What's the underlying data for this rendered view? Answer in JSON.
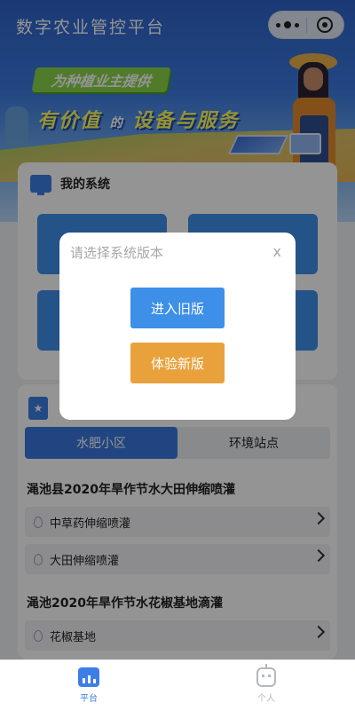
{
  "header": {
    "app_title": "数字农业管控平台",
    "banner_tag": "为种植业主提供",
    "banner_slogan_part1": "有价值",
    "banner_slogan_part2": "的",
    "banner_slogan_part3": "设备与服务"
  },
  "my_system": {
    "title": "我的系统",
    "tiles": [
      "",
      "",
      "",
      ""
    ]
  },
  "sites": {
    "tabs": [
      {
        "label": "水肥小区",
        "active": true
      },
      {
        "label": "环境站点",
        "active": false
      }
    ],
    "groups": [
      {
        "title": "渑池县2020年旱作节水大田伸缩喷灌",
        "items": [
          "中草药伸缩喷灌",
          "大田伸缩喷灌"
        ]
      },
      {
        "title": "渑池2020年旱作节水花椒基地滴灌",
        "items": [
          "花椒基地"
        ]
      }
    ]
  },
  "dialog": {
    "title": "请选择系统版本",
    "close": "x",
    "old_version": "进入旧版",
    "new_version": "体验新版"
  },
  "tabbar": {
    "items": [
      {
        "label": "平台",
        "icon": "chart-icon",
        "active": true
      },
      {
        "label": "个人",
        "icon": "robot-icon",
        "active": false
      }
    ]
  },
  "colors": {
    "primary_blue": "#3d7ee6",
    "accent_orange": "#e9a23b",
    "banner_green": "#8bd44a"
  }
}
